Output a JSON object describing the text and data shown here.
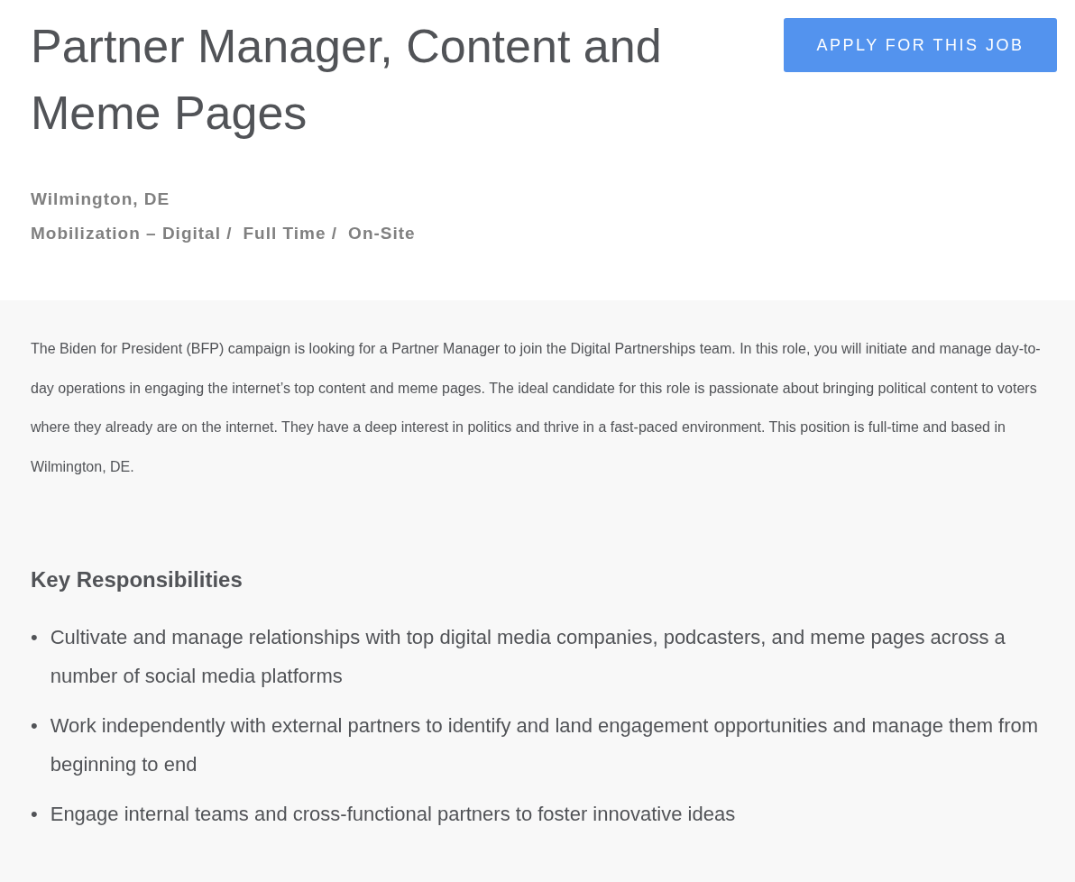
{
  "job": {
    "title": "Partner Manager, Content and Meme Pages",
    "location": "Wilmington, DE",
    "categories": [
      "Mobilization – Digital /",
      "Full Time /",
      "On-Site"
    ]
  },
  "apply_button": {
    "label": "APPLY FOR THIS JOB"
  },
  "description": "The Biden for President (BFP) campaign is looking for a Partner Manager to join the Digital Partnerships team. In this role, you will initiate and manage day-to-day operations in engaging the internet’s top content and meme pages. The ideal candidate for this role is passionate about bringing political content to voters where they already are on the internet. They have a deep interest in politics and thrive in a fast-paced environment. This position is full-time and based in Wilmington, DE.",
  "section": {
    "heading": "Key Responsibilities",
    "items": [
      {
        "bullet": "•",
        "text": "Cultivate and manage relationships with top digital media companies, podcasters, and meme pages across a number of social media platforms"
      },
      {
        "bullet": "•",
        "text": "Work independently with external partners to identify and land engagement opportunities and manage them from beginning to end"
      },
      {
        "bullet": "•",
        "text": "Engage internal teams and cross-functional partners to foster innovative ideas"
      }
    ]
  }
}
